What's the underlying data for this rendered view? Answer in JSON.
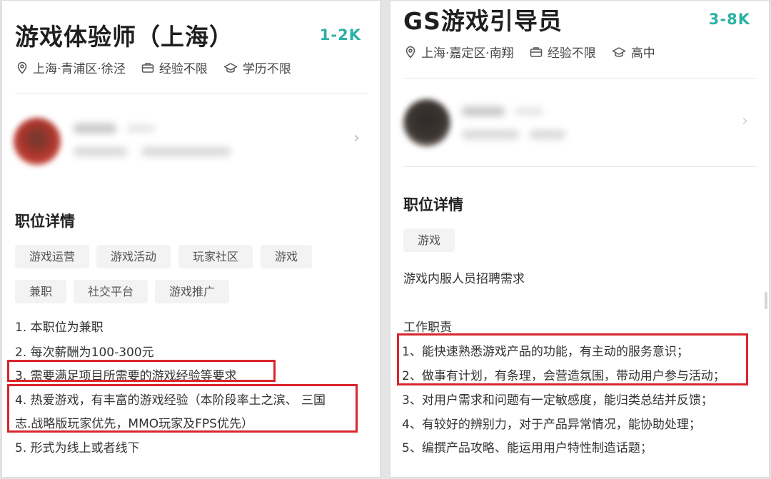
{
  "left": {
    "title": "游戏体验师（上海）",
    "salary": "1-2K",
    "location": "上海·青浦区·徐泾",
    "experience": "经验不限",
    "education": "学历不限",
    "section_title": "职位详情",
    "tags": [
      "游戏运营",
      "游戏活动",
      "玩家社区",
      "游戏",
      "兼职",
      "社交平台",
      "游戏推广"
    ],
    "lines": [
      "1. 本职位为兼职",
      "2. 每次薪酬为100-300元",
      "3. 需要满足项目所需要的游戏经验等要求",
      "4. 热爱游戏，有丰富的游戏经验（本阶段率土之滨、 三国",
      "志.战略版玩家优先，MMO玩家及FPS优先）",
      "5. 形式为线上或者线下"
    ]
  },
  "right": {
    "title": "GS游戏引导员",
    "salary": "3-8K",
    "location": "上海·嘉定区·南翔",
    "experience": "经验不限",
    "education": "高中",
    "section_title": "职位详情",
    "tags": [
      "游戏"
    ],
    "summary": "游戏内服人员招聘需求",
    "duty_heading": "工作职责",
    "duties": [
      "1、能快速熟悉游戏产品的功能，有主动的服务意识；",
      "2、做事有计划，有条理，会营造氛围，带动用户参与活动；",
      "3、对用户需求和问题有一定敏感度，能归类总结并反馈；",
      "4、有较好的辨别力，对于产品异常情况，能协助处理；",
      "5、编撰产品攻略、能运用用户特性制造话题；"
    ]
  },
  "colors": {
    "salary": "#2bb2a4",
    "highlight_box": "#d9252c"
  },
  "icons": [
    "location-pin-icon",
    "briefcase-icon",
    "graduation-cap-icon",
    "chevron-right-icon"
  ]
}
